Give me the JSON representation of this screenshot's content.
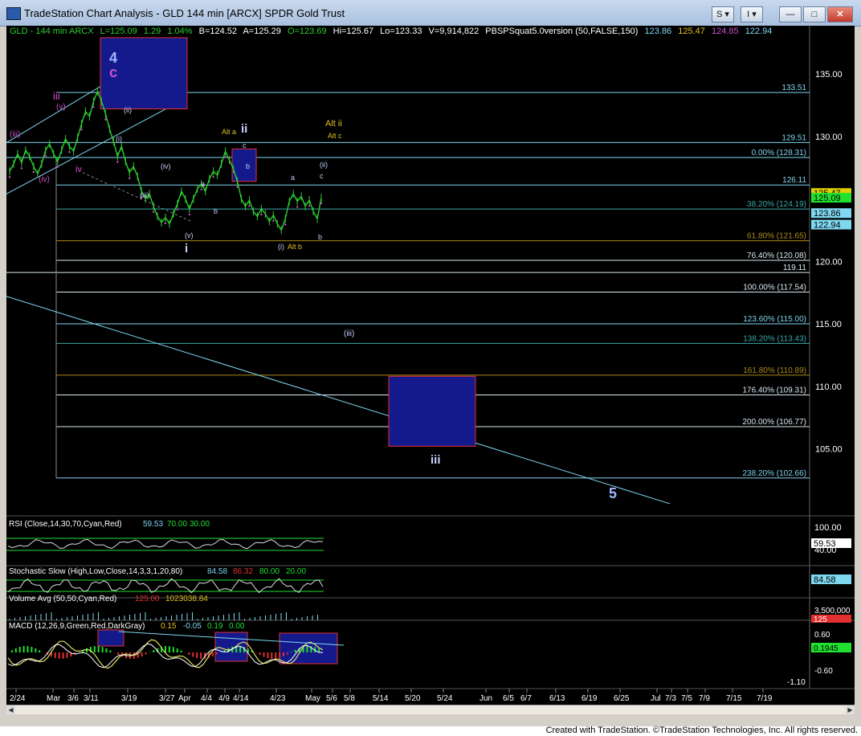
{
  "window": {
    "title": "TradeStation Chart Analysis - GLD 144 min [ARCX] SPDR Gold Trust",
    "btn_s": "S ▾",
    "btn_i": "I ▾",
    "btn_min": "—",
    "btn_max": "□",
    "btn_close": "✕"
  },
  "header": {
    "symbol": "GLD - 144 min  ARCX",
    "last": "L=125.09",
    "change": "1.29",
    "pct": "1.04%",
    "bid": "B=124.52",
    "ask": "A=125.29",
    "open": "O=123.69",
    "high": "Hi=125.67",
    "low": "Lo=123.33",
    "volume": "V=9,914,822",
    "study": "PBSPSquat5.0version (50,FALSE,150)",
    "v1": "123.86",
    "v2": "125.47",
    "v3": "124.85",
    "v4": "122.94"
  },
  "colors": {
    "cyan": "#7fd7f0",
    "green": "#2ecc2e",
    "magenta": "#d050d0",
    "yellow": "#e0c020",
    "price_axis_green": "#20e030",
    "box_fill": "#141a8c",
    "box_stroke": "#e23030"
  },
  "chart_data": {
    "type": "line",
    "title": "GLD - 144 min ARCX",
    "price_axis": {
      "min": 100,
      "max": 137.5,
      "ticks": [
        135,
        130,
        125,
        120,
        115,
        110,
        105
      ]
    },
    "date_ticks": [
      "2/24",
      "Mar",
      "3/6",
      "3/11",
      "3/19",
      "3/27",
      "Apr",
      "4/4",
      "4/9",
      "4/14",
      "4/23",
      "May",
      "5/6",
      "5/8",
      "5/14",
      "5/20",
      "5/24",
      "Jun",
      "6/5",
      "6/7",
      "6/13",
      "6/19",
      "6/25",
      "Jul",
      "7/3",
      "7/5",
      "7/9",
      "7/15",
      "7/19"
    ],
    "price_series": {
      "name": "GLD",
      "values": [
        127.2,
        127.8,
        128.6,
        127.9,
        128.9,
        128.4,
        127.6,
        127.0,
        127.8,
        128.9,
        129.4,
        128.6,
        128.0,
        128.9,
        129.8,
        129.2,
        128.8,
        129.9,
        131.0,
        132.0,
        131.6,
        132.8,
        133.6,
        132.8,
        131.8,
        130.6,
        129.6,
        128.4,
        129.2,
        128.0,
        127.1,
        127.6,
        126.8,
        125.6,
        125.0,
        125.4,
        124.4,
        123.6,
        123.1,
        123.5,
        123.0,
        123.8,
        124.6,
        125.6,
        125.0,
        124.2,
        125.0,
        125.8,
        126.2,
        125.6,
        126.6,
        127.2,
        126.9,
        127.8,
        128.8,
        128.1,
        127.4,
        126.4,
        125.0,
        124.4,
        124.9,
        124.0,
        123.6,
        124.2,
        123.8,
        123.2,
        123.7,
        123.0,
        122.5,
        123.4,
        124.8,
        125.4,
        124.8,
        125.2,
        124.4,
        124.9,
        124.0,
        123.4,
        125.09
      ]
    },
    "horizontal_levels": [
      {
        "label": "133.51",
        "value": 133.51,
        "type": "cyan"
      },
      {
        "label": "129.51",
        "value": 129.51,
        "type": "cyan"
      },
      {
        "label": "0.00% (128.31)",
        "value": 128.31,
        "type": "cyan"
      },
      {
        "label": "126.11",
        "value": 126.11,
        "type": "cyan"
      },
      {
        "label": "38.20% (124.19)",
        "value": 124.19,
        "type": "teal"
      },
      {
        "label": "61.80% (121.65)",
        "value": 121.65,
        "type": "gold"
      },
      {
        "label": "76.40% (120.08)",
        "value": 120.08,
        "type": "white"
      },
      {
        "label": "119.11",
        "value": 119.11,
        "type": "white"
      },
      {
        "label": "100.00% (117.54)",
        "value": 117.54,
        "type": "white"
      },
      {
        "label": "123.60% (115.00)",
        "value": 115.0,
        "type": "cyan"
      },
      {
        "label": "138.20% (113.43)",
        "value": 113.43,
        "type": "teal"
      },
      {
        "label": "161.80% (110.89)",
        "value": 110.89,
        "type": "gold"
      },
      {
        "label": "176.40% (109.31)",
        "value": 109.31,
        "type": "white"
      },
      {
        "label": "200.00% (106.77)",
        "value": 106.77,
        "type": "white"
      },
      {
        "label": "238.20% (102.66)",
        "value": 102.66,
        "type": "cyan"
      }
    ],
    "axis_badges": [
      "125.47",
      "125.09",
      "123.86",
      "122.94"
    ],
    "wave_labels": [
      {
        "text": "4",
        "color": "#9fb8ff",
        "big": true
      },
      {
        "text": "c",
        "color": "#d050d0",
        "big": true
      },
      {
        "text": "iii",
        "color": "#d050d0"
      },
      {
        "text": "(v)",
        "color": "#d050d0"
      },
      {
        "text": "(iii)",
        "color": "#d050d0"
      },
      {
        "text": "(iv)",
        "color": "#d050d0"
      },
      {
        "text": "iv",
        "color": "#d050d0"
      },
      {
        "text": "(ii)",
        "color": "#c8d0ff"
      },
      {
        "text": "(i)",
        "color": "#c8d0ff"
      },
      {
        "text": "(iv)",
        "color": "#c8d0ff"
      },
      {
        "text": "(iii)",
        "color": "#c8d0ff"
      },
      {
        "text": "a",
        "color": "#c8d0ff"
      },
      {
        "text": "b",
        "color": "#c8d0ff"
      },
      {
        "text": "(v)",
        "color": "#c8d0ff"
      },
      {
        "text": "i",
        "color": "#c8d0ff",
        "big": true
      },
      {
        "text": "Alt a",
        "color": "#e0c020"
      },
      {
        "text": "ii",
        "color": "#c8d0ff",
        "big": true
      },
      {
        "text": "c",
        "color": "#c8d0ff"
      },
      {
        "text": "b",
        "color": "#c8d0ff"
      },
      {
        "text": "a",
        "color": "#c8d0ff"
      },
      {
        "text": "(ii)",
        "color": "#c8d0ff"
      },
      {
        "text": "c",
        "color": "#c8d0ff"
      },
      {
        "text": "b",
        "color": "#c8d0ff"
      },
      {
        "text": "(i)",
        "color": "#c8d0ff"
      },
      {
        "text": "Alt b",
        "color": "#e0c020"
      },
      {
        "text": "Alt ii",
        "color": "#e0c020"
      },
      {
        "text": "Alt c",
        "color": "#e0c020"
      },
      {
        "text": "(iii)",
        "color": "#c8d0ff"
      },
      {
        "text": "iii",
        "color": "#c8d0ff",
        "big": true
      },
      {
        "text": "5",
        "color": "#9fb8ff",
        "big": true
      }
    ],
    "indicators": {
      "rsi": {
        "label": "RSI (Close,14,30,70,Cyan,Red)",
        "value": "59.53",
        "ob": "70.00",
        "os": "30.00",
        "axis_top": "100.00",
        "axis_mid": "40.00",
        "badge": "59.53"
      },
      "stoch": {
        "label": "Stochastic Slow (High,Low,Close,14,3,3,1,20,80)",
        "k": "84.58",
        "d": "86.32",
        "ob": "80.00",
        "os": "20.00",
        "badge": "84.58"
      },
      "volume": {
        "label": "Volume Avg (50,50,Cyan,Red)",
        "v": "125.00",
        "avg": "1023038.84",
        "axis_top": "3,500,000",
        "badge": "125"
      },
      "macd": {
        "label": "MACD (12,26,9,Green,Red,DarkGray)",
        "v1": "0.15",
        "v2": "-0.05",
        "v3": "0.19",
        "v4": "0.00",
        "axis_top": "0.60",
        "axis_bot": "-0.60",
        "axis_min": "-1.10",
        "badge": "0.1945"
      }
    }
  },
  "footer": {
    "text": "Created with TradeStation. ©TradeStation Technologies, Inc. All rights reserved."
  }
}
